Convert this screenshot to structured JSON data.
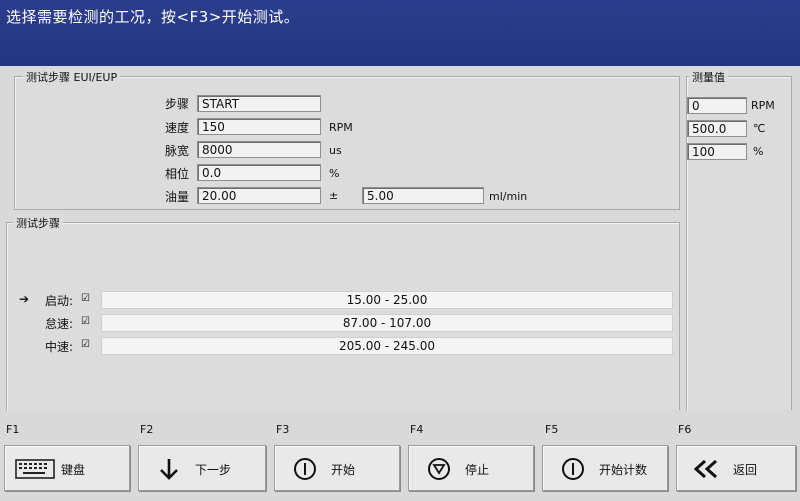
{
  "title": "选择需要检测的工况，按<F3>开始测试。",
  "test_params": {
    "header": "测试步骤 EUI/EUP",
    "step_label": "步骤",
    "step_value": "START",
    "speed_label": "速度",
    "speed_value": "150",
    "speed_unit": "RPM",
    "pulse_label": "脉宽",
    "pulse_value": "8000",
    "pulse_unit": "us",
    "phase_label": "相位",
    "phase_value": "0.0",
    "phase_unit": "%",
    "oil_label": "油量",
    "oil_value": "20.00",
    "oil_pm": "±",
    "oil_tol": "5.00",
    "oil_unit": "ml/min"
  },
  "measured": {
    "header": "测量值",
    "rpm_value": "0",
    "rpm_unit": "RPM",
    "temp_value": "500.0",
    "temp_unit": "℃",
    "pct_value": "100",
    "pct_unit": "%"
  },
  "steps": {
    "header": "测试步骤",
    "items": [
      {
        "label": "启动:",
        "check": "☑",
        "range": "15.00 - 25.00"
      },
      {
        "label": "怠速:",
        "check": "☑",
        "range": "87.00 - 107.00"
      },
      {
        "label": "中速:",
        "check": "☑",
        "range": "205.00 - 245.00"
      }
    ]
  },
  "fkeys": {
    "f1": {
      "key": "F1",
      "label": "键盘"
    },
    "f2": {
      "key": "F2",
      "label": "下一步"
    },
    "f3": {
      "key": "F3",
      "label": "开始"
    },
    "f4": {
      "key": "F4",
      "label": "停止"
    },
    "f5": {
      "key": "F5",
      "label": "开始计数"
    },
    "f6": {
      "key": "F6",
      "label": "返回"
    }
  }
}
